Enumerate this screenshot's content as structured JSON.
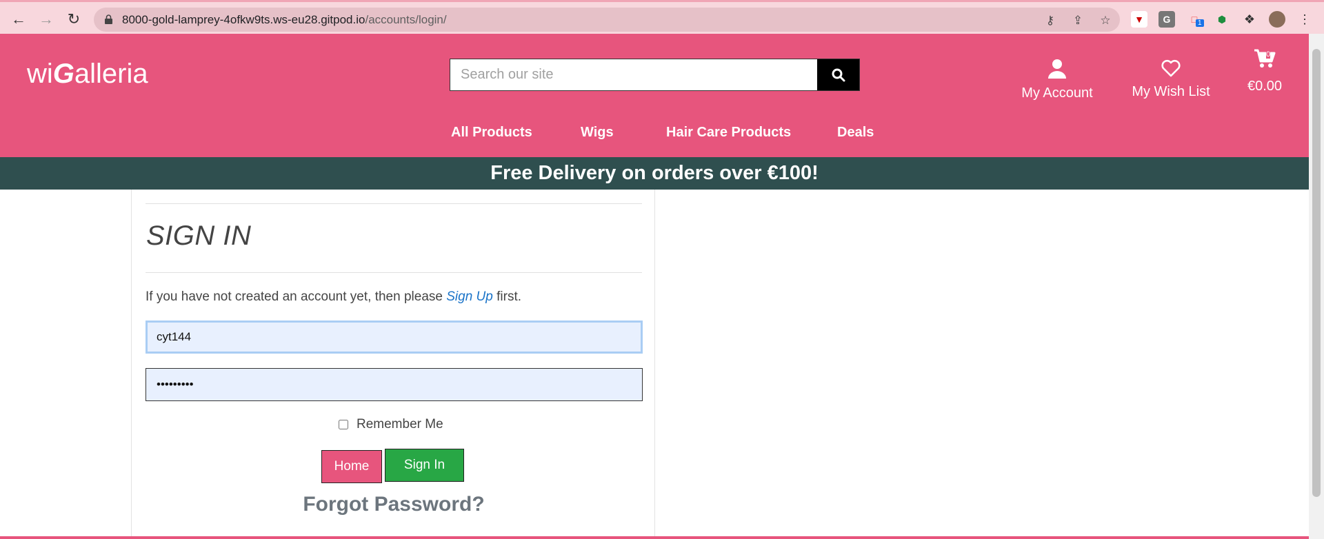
{
  "browser": {
    "url_host": "8000-gold-lamprey-4ofkw9ts.ws-eu28.gitpod.io",
    "url_path": "/accounts/login/",
    "extension_badge": "1"
  },
  "header": {
    "logo_pre": "wi",
    "logo_g": "G",
    "logo_post": "alleria",
    "search_placeholder": "Search our site",
    "account_label": "My Account",
    "wishlist_label": "My Wish List",
    "cart_total": "€0.00",
    "cart_count": "0"
  },
  "nav": {
    "items": [
      "All Products",
      "Wigs",
      "Hair Care Products",
      "Deals"
    ]
  },
  "promo": "Free Delivery on orders over €100!",
  "login": {
    "title": "SIGN IN",
    "intro_pre": "If you have not created an account yet, then please ",
    "signup_link": "Sign Up",
    "intro_post": " first.",
    "username_value": "cyt144",
    "password_value": "•••••••••",
    "remember_label": "Remember Me",
    "home_button": "Home",
    "signin_button": "Sign In",
    "forgot_link": "Forgot Password?"
  },
  "colors": {
    "brand": "#e7557d",
    "promo_bg": "#2f4f4f",
    "signin_green": "#28a745"
  }
}
